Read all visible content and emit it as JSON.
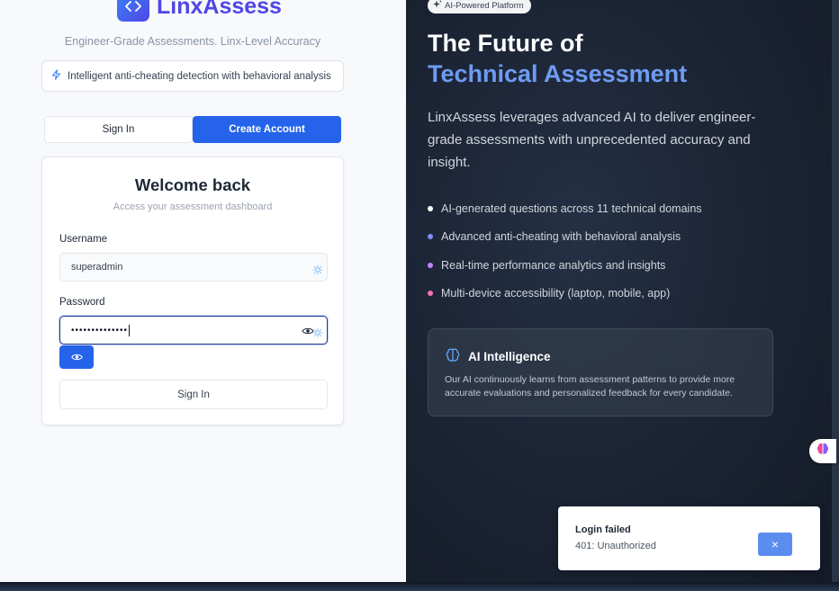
{
  "brand": {
    "name": "LinxAssess",
    "logo_icon": "code-brackets-icon"
  },
  "login_panel": {
    "tagline": "Engineer-Grade Assessments. Linx-Level Accuracy",
    "feature_pill": "Intelligent anti-cheating detection with behavioral analysis",
    "tabs": {
      "sign_in": "Sign In",
      "create_account": "Create Account",
      "active": "create_account"
    },
    "card": {
      "title": "Welcome back",
      "subtitle": "Access your assessment dashboard",
      "username_label": "Username",
      "username_value": "superadmin",
      "password_label": "Password",
      "password_masked": "••••••••••••••",
      "submit_label": "Sign In"
    }
  },
  "hero_panel": {
    "badge": "AI-Powered Platform",
    "headline_line1": "The Future of",
    "headline_line2": "Technical Assessment",
    "description": "LinxAssess leverages advanced AI to deliver engineer-grade assessments with unprecedented accuracy and insight.",
    "bullets": [
      {
        "text": "AI-generated questions across 11 technical domains",
        "dot_color": "#ffffff"
      },
      {
        "text": "Advanced anti-cheating with behavioral analysis",
        "dot_color": "#818cf8"
      },
      {
        "text": "Real-time performance analytics and insights",
        "dot_color": "#c084fc"
      },
      {
        "text": "Multi-device accessibility (laptop, mobile, app)",
        "dot_color": "#f472b6"
      }
    ],
    "ai_card": {
      "title": "AI Intelligence",
      "body": "Our AI continuously learns from assessment patterns to provide more accurate evaluations and personalized feedback for every candidate."
    }
  },
  "toast": {
    "title": "Login failed",
    "message": "401: Unauthorized",
    "close_label": "×"
  },
  "colors": {
    "primary": "#2563eb",
    "brand": "#4f46e5",
    "hero_accent": "#6f9bf2",
    "dark_bg": "#1b2333"
  }
}
